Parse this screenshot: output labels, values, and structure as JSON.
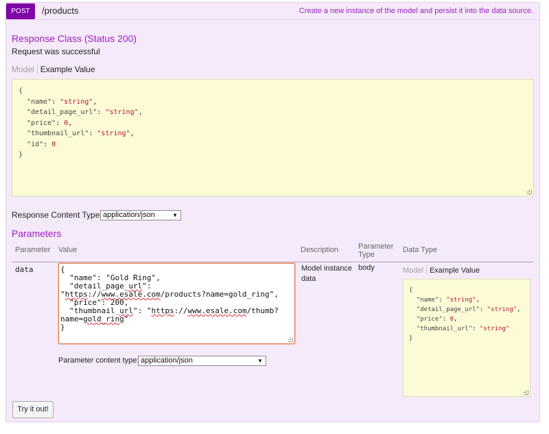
{
  "operation": {
    "method": "POST",
    "path": "/products",
    "summary": "Create a new instance of the model and persist it into the data source."
  },
  "response": {
    "heading": "Response Class (Status 200)",
    "message": "Request was successful",
    "tab_model": "Model",
    "tab_example": "Example Value",
    "example_lines": [
      "{",
      "  \"name\": \"string\",",
      "  \"detail_page_url\": \"string\",",
      "  \"price\": 0,",
      "  \"thumbnail_url\": \"string\",",
      "  \"id\": 0",
      "}"
    ],
    "content_type_label": "Response Content Type",
    "content_type_value": "application/json"
  },
  "parameters": {
    "heading": "Parameters",
    "columns": {
      "parameter": "Parameter",
      "value": "Value",
      "description": "Description",
      "parameter_type": "Parameter Type",
      "data_type": "Data Type"
    },
    "row": {
      "name": "data",
      "description": "Model instance data",
      "type": "body",
      "body_value_lines": [
        "{",
        "  \"name\": \"Gold Ring\",",
        "  \"detail_page_url\":",
        "\"https://www.esale.com/products?name=gold_ring\",",
        "  \"price\": 200,",
        "  \"thumbnail_url\": \"https://www.esale.com/thumb?",
        "name=gold_ring\"",
        "}"
      ],
      "content_type_label": "Parameter content type:",
      "content_type_value": "application/json",
      "model_tab": "Model",
      "example_tab": "Example Value",
      "example_lines": [
        "{",
        "  \"name\": \"string\",",
        "  \"detail_page_url\": \"string\",",
        "  \"price\": 0,",
        "  \"thumbnail_url\": \"string\"",
        "}"
      ]
    }
  },
  "try_button": "Try it out!"
}
